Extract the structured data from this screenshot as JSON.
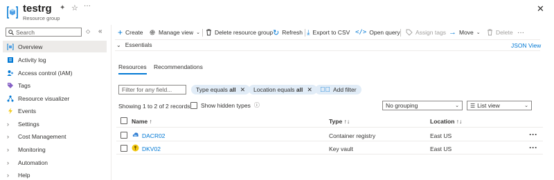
{
  "header": {
    "title": "testrg",
    "subtitle": "Resource group"
  },
  "sidebar": {
    "search_placeholder": "Search",
    "items": [
      {
        "label": "Overview",
        "icon": "overview-icon",
        "active": true
      },
      {
        "label": "Activity log",
        "icon": "activity-log-icon"
      },
      {
        "label": "Access control (IAM)",
        "icon": "iam-icon"
      },
      {
        "label": "Tags",
        "icon": "tag-icon"
      },
      {
        "label": "Resource visualizer",
        "icon": "visualizer-icon"
      },
      {
        "label": "Events",
        "icon": "lightning-icon"
      },
      {
        "label": "Settings",
        "icon": "chevron-right-icon"
      },
      {
        "label": "Cost Management",
        "icon": "chevron-right-icon"
      },
      {
        "label": "Monitoring",
        "icon": "chevron-right-icon"
      },
      {
        "label": "Automation",
        "icon": "chevron-right-icon"
      },
      {
        "label": "Help",
        "icon": "chevron-right-icon"
      }
    ]
  },
  "toolbar": {
    "create": "Create",
    "manage_view": "Manage view",
    "delete_rg": "Delete resource group",
    "refresh": "Refresh",
    "export_csv": "Export to CSV",
    "open_query": "Open query",
    "assign_tags": "Assign tags",
    "move": "Move",
    "delete": "Delete"
  },
  "essentials": {
    "label": "Essentials",
    "json_view": "JSON View"
  },
  "tabs": {
    "resources": "Resources",
    "recommendations": "Recommendations"
  },
  "filters": {
    "placeholder": "Filter for any field...",
    "type_label": "Type equals",
    "type_value": "all",
    "location_label": "Location equals",
    "location_value": "all",
    "add_filter": "Add filter"
  },
  "records": {
    "showing": "Showing 1 to 2 of 2 records.",
    "show_hidden": "Show hidden types",
    "grouping": "No grouping",
    "view": "List view"
  },
  "table": {
    "columns": {
      "name": "Name ↑",
      "type": "Type ↑↓",
      "location": "Location ↑↓"
    },
    "rows": [
      {
        "name": "DACR02",
        "type": "Container registry",
        "location": "East US",
        "icon": "container-registry-icon"
      },
      {
        "name": "DKV02",
        "type": "Key vault",
        "location": "East US",
        "icon": "key-vault-icon"
      }
    ]
  },
  "colors": {
    "accent": "#0078d4",
    "pill_bg": "#e1ecf7",
    "selected_nav": "#edebe9"
  }
}
